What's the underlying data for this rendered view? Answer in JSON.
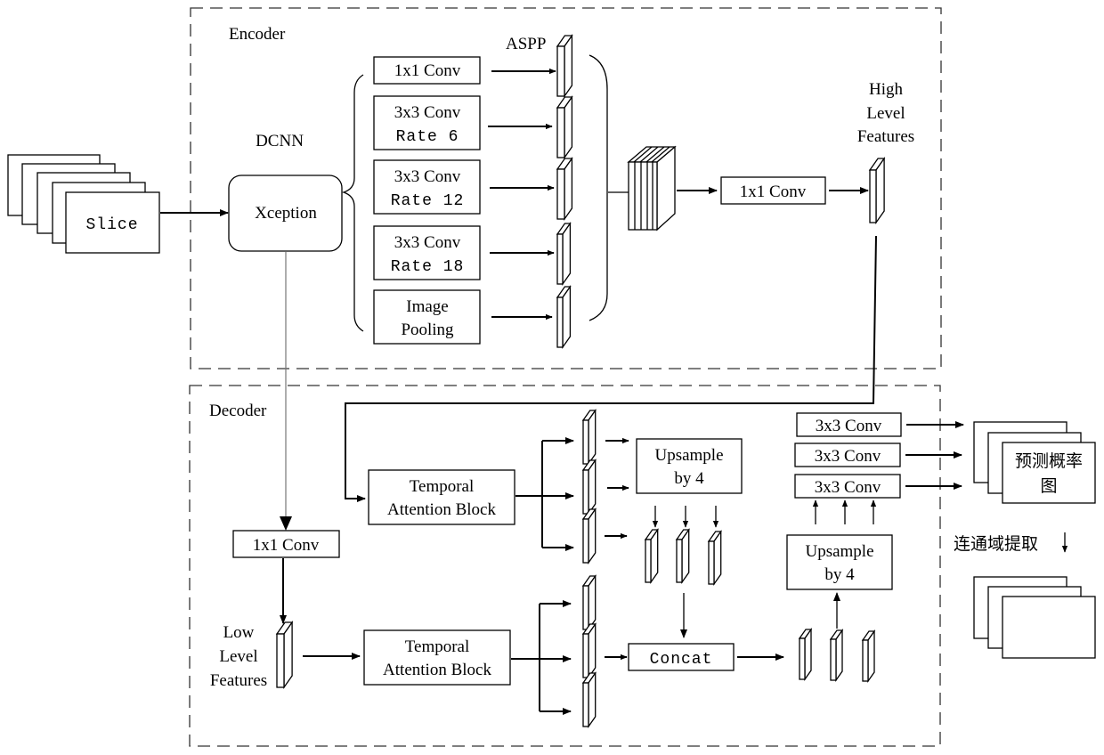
{
  "diagram": {
    "sections": {
      "encoder": {
        "label": "Encoder"
      },
      "decoder": {
        "label": "Decoder"
      }
    },
    "input": {
      "label": "Slice",
      "stack_count": 5
    },
    "dcnn": {
      "title": "DCNN",
      "backbone": "Xception"
    },
    "aspp": {
      "title": "ASPP",
      "branches": [
        {
          "line1": "1x1 Conv",
          "line2": ""
        },
        {
          "line1": "3x3 Conv",
          "line2": "Rate 6"
        },
        {
          "line1": "3x3 Conv",
          "line2": "Rate 12"
        },
        {
          "line1": "3x3 Conv",
          "line2": "Rate 18"
        },
        {
          "line1": "Image",
          "line2": "Pooling"
        }
      ]
    },
    "encoder_conv": {
      "label": "1x1 Conv"
    },
    "high_level": {
      "line1": "High",
      "line2": "Level",
      "line3": "Features"
    },
    "low_level": {
      "line1": "Low",
      "line2": "Level",
      "line3": "Features"
    },
    "decoder_conv": {
      "label": "1x1 Conv"
    },
    "tab_top": {
      "line1": "Temporal",
      "line2": "Attention Block"
    },
    "tab_bottom": {
      "line1": "Temporal",
      "line2": "Attention Block"
    },
    "upsample_top": {
      "line1": "Upsample",
      "line2": "by 4"
    },
    "upsample_right": {
      "line1": "Upsample",
      "line2": "by 4"
    },
    "concat": {
      "label": "Concat"
    },
    "output_convs": [
      "3x3 Conv",
      "3x3 Conv",
      "3x3 Conv"
    ],
    "prediction": {
      "line1": "预测概率",
      "line2": "图"
    },
    "extraction": {
      "label": "连通域提取"
    }
  }
}
